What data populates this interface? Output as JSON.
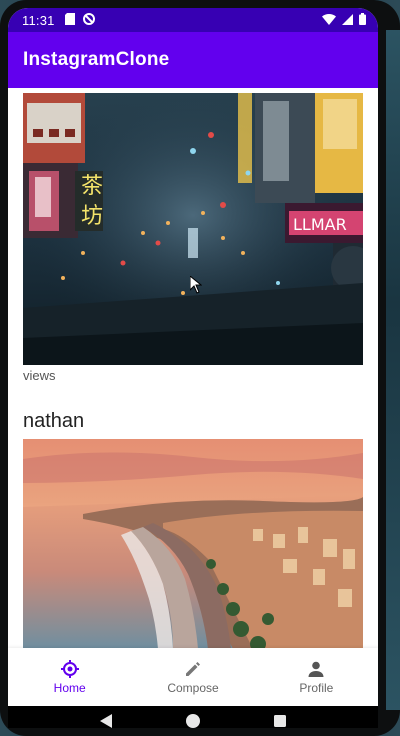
{
  "status_bar": {
    "time": "11:31",
    "icons_left": [
      "sd-card-icon",
      "do-not-disturb-icon"
    ],
    "icons_right": [
      "wifi-icon",
      "signal-icon",
      "battery-icon"
    ]
  },
  "app_bar": {
    "title": "InstagramClone"
  },
  "feed": {
    "posts": [
      {
        "username": "",
        "image": "neon-city-night-photo",
        "caption": "views"
      },
      {
        "username": "nathan",
        "image": "coastal-city-sunset-photo",
        "caption": ""
      }
    ]
  },
  "bottom_nav": {
    "items": [
      {
        "label": "Home",
        "icon": "home-target-icon",
        "active": true
      },
      {
        "label": "Compose",
        "icon": "pencil-icon",
        "active": false
      },
      {
        "label": "Profile",
        "icon": "person-icon",
        "active": false
      }
    ]
  },
  "colors": {
    "status_bar": "#3700b3",
    "app_bar": "#6200ee",
    "active_nav": "#6200ee"
  }
}
